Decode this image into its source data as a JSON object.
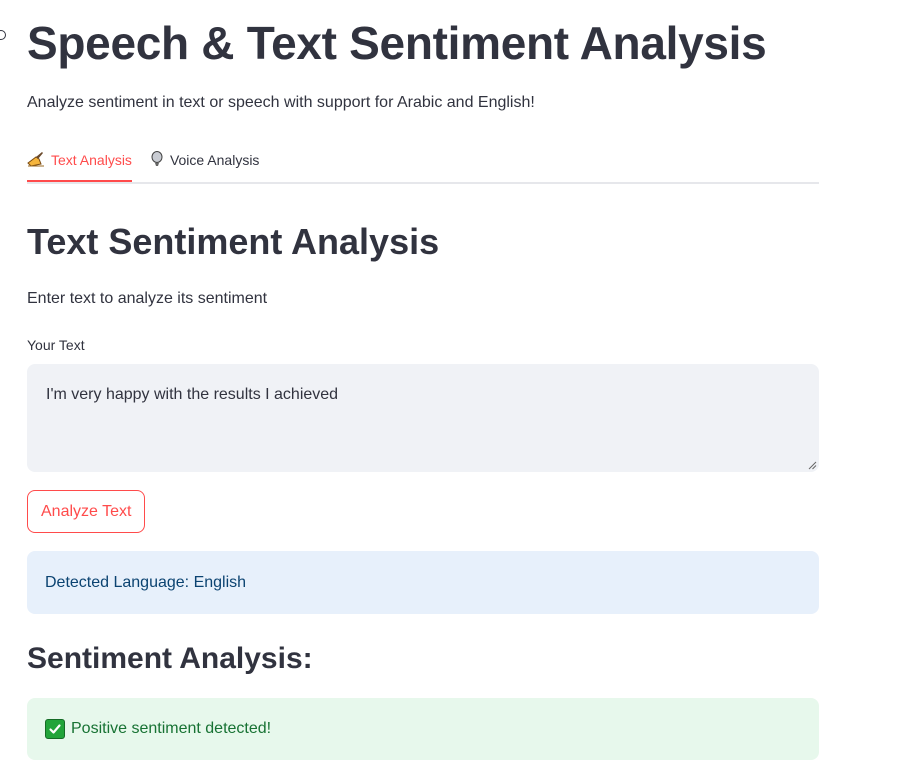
{
  "header": {
    "title": "Speech & Text Sentiment Analysis",
    "subtitle": "Analyze sentiment in text or speech with support for Arabic and English!"
  },
  "tabs": [
    {
      "label": "Text Analysis",
      "icon": "writing-hand-icon",
      "active": true
    },
    {
      "label": "Voice Analysis",
      "icon": "microphone-icon",
      "active": false
    }
  ],
  "text_section": {
    "title": "Text Sentiment Analysis",
    "description": "Enter text to analyze its sentiment",
    "input_label": "Your Text",
    "input_value": "I'm very happy with the results I achieved",
    "button_label": "Analyze Text"
  },
  "results": {
    "language_message": "Detected Language: English",
    "sentiment_title": "Sentiment Analysis:",
    "sentiment_message": "Positive sentiment detected!"
  },
  "colors": {
    "accent": "#ff4b4b",
    "info_bg": "#e7f0fb",
    "info_text": "#0b4371",
    "success_bg": "#e7f8ec",
    "success_text": "#177233",
    "text": "#31333f"
  }
}
